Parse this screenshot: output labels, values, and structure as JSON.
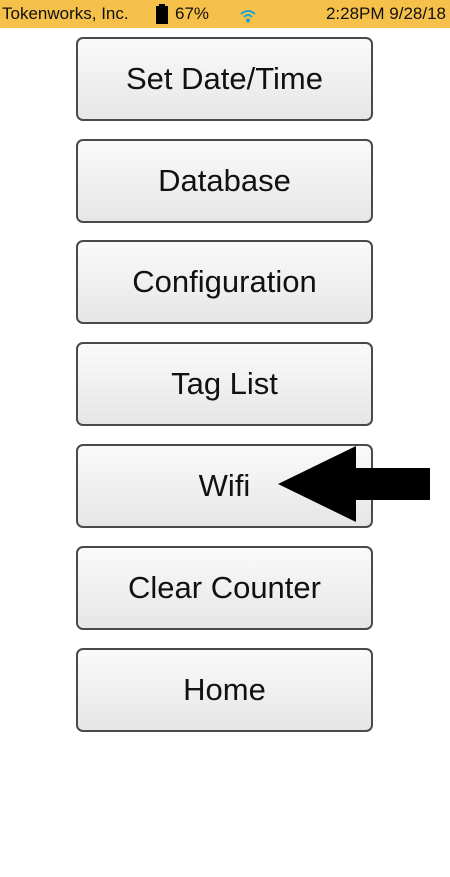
{
  "status_bar": {
    "company": "Tokenworks, Inc.",
    "battery": "67%",
    "time": "2:28PM 9/28/18",
    "battery_icon": "battery-icon",
    "wifi_icon": "wifi-icon"
  },
  "menu": {
    "set_datetime": "Set Date/Time",
    "database": "Database",
    "configuration": "Configuration",
    "tag_list": "Tag List",
    "wifi": "Wifi",
    "clear_counter": "Clear Counter",
    "home": "Home"
  },
  "annotation": {
    "arrow_icon": "arrow-left-icon",
    "points_to": "wifi"
  },
  "colors": {
    "status_bar_bg": "#f6c14a",
    "wifi_icon": "#1ba3d6",
    "button_border": "#4a4a4a",
    "arrow": "#000000"
  }
}
